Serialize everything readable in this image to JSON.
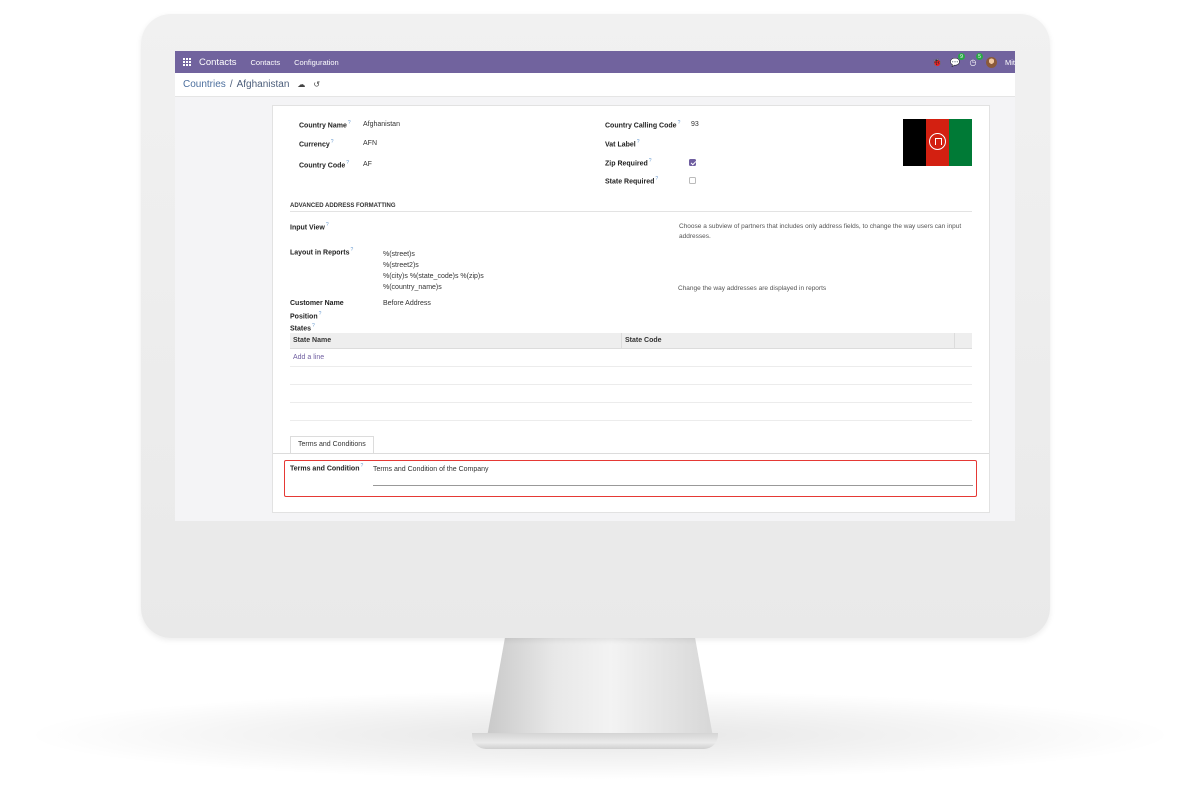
{
  "navbar": {
    "brand": "Contacts",
    "menu": [
      "Contacts",
      "Configuration"
    ],
    "messages_badge": "9",
    "activities_badge": "5",
    "user": "Mit"
  },
  "breadcrumb": {
    "parent": "Countries",
    "separator": "/",
    "current": "Afghanistan"
  },
  "form": {
    "country_name_label": "Country Name",
    "country_name": "Afghanistan",
    "currency_label": "Currency",
    "currency": "AFN",
    "country_code_label": "Country Code",
    "country_code": "AF",
    "calling_code_label": "Country Calling Code",
    "calling_code": "93",
    "vat_label_label": "Vat Label",
    "zip_required_label": "Zip Required",
    "zip_required": true,
    "state_required_label": "State Required",
    "state_required": false
  },
  "flag_colors": [
    "#000000",
    "#d32011",
    "#007a36"
  ],
  "advanced": {
    "title": "ADVANCED ADDRESS FORMATTING",
    "input_view_label": "Input View",
    "input_view_help": "Choose a subview of partners that includes only address fields, to change the way users can input addresses.",
    "layout_label": "Layout in Reports",
    "layout_lines": [
      "%(street)s",
      "%(street2)s",
      "%(city)s %(state_code)s %(zip)s",
      "%(country_name)s"
    ],
    "layout_help": "Change the way addresses are displayed in reports",
    "customer_name_label_1": "Customer Name",
    "customer_name_label_2": "Position",
    "customer_name_position": "Before Address",
    "states_label": "States"
  },
  "states_table": {
    "headers": [
      "State Name",
      "State Code"
    ],
    "add_line": "Add a line"
  },
  "tabs": [
    "Terms and Conditions"
  ],
  "terms": {
    "label": "Terms and Condition",
    "value": "Terms and Condition of the Company"
  },
  "colors": {
    "navbar": "#71639e",
    "accent": "#6f5ea0",
    "highlight": "#e53935"
  }
}
